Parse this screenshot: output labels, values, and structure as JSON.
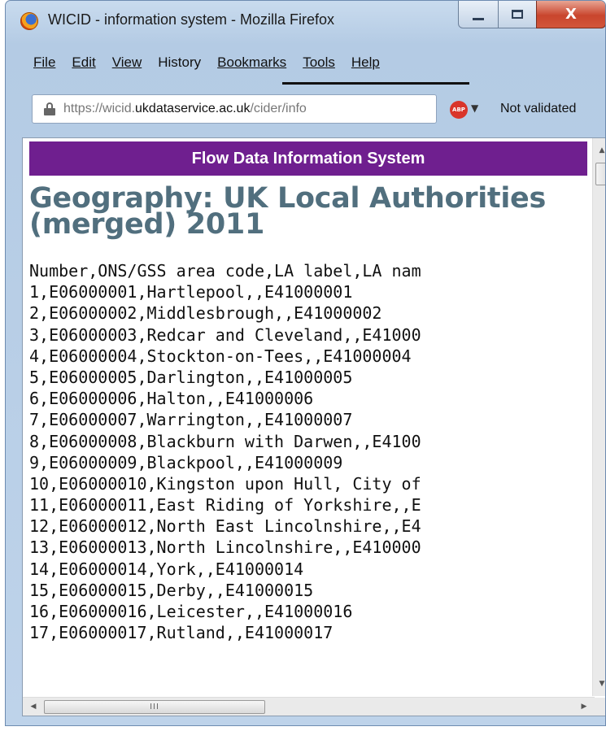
{
  "window": {
    "title": "WICID - information system - Mozilla Firefox",
    "minimize_icon": "minimize-icon",
    "maximize_icon": "maximize-icon",
    "close_label": "X"
  },
  "menu": {
    "file": "File",
    "edit": "Edit",
    "view": "View",
    "history": "History",
    "bookmarks": "Bookmarks",
    "tools": "Tools",
    "help": "Help"
  },
  "address_bar": {
    "url_prefix": "https://wicid.",
    "url_domain": "ukdataservice.ac.uk",
    "url_path": "/cider/info",
    "adblock_label": "ABP",
    "status": "Not validated"
  },
  "page": {
    "banner": "Flow Data Information System",
    "heading": "Geography: UK Local Authorities (merged) 2011",
    "lines": [
      "Number,ONS/GSS area code,LA label,LA nam",
      "1,E06000001,Hartlepool,,E41000001",
      "2,E06000002,Middlesbrough,,E41000002",
      "3,E06000003,Redcar and Cleveland,,E41000",
      "4,E06000004,Stockton-on-Tees,,E41000004",
      "5,E06000005,Darlington,,E41000005",
      "6,E06000006,Halton,,E41000006",
      "7,E06000007,Warrington,,E41000007",
      "8,E06000008,Blackburn with Darwen,,E4100",
      "9,E06000009,Blackpool,,E41000009",
      "10,E06000010,Kingston upon Hull, City of",
      "11,E06000011,East Riding of Yorkshire,,E",
      "12,E06000012,North East Lincolnshire,,E4",
      "13,E06000013,North Lincolnshire,,E410000",
      "14,E06000014,York,,E41000014",
      "15,E06000015,Derby,,E41000015",
      "16,E06000016,Leicester,,E41000016",
      "17,E06000017,Rutland,,E41000017"
    ]
  },
  "scrollbar": {
    "h_thumb_grip": "III"
  },
  "colors": {
    "banner_bg": "#6f1f8f",
    "heading": "#516f7e"
  }
}
